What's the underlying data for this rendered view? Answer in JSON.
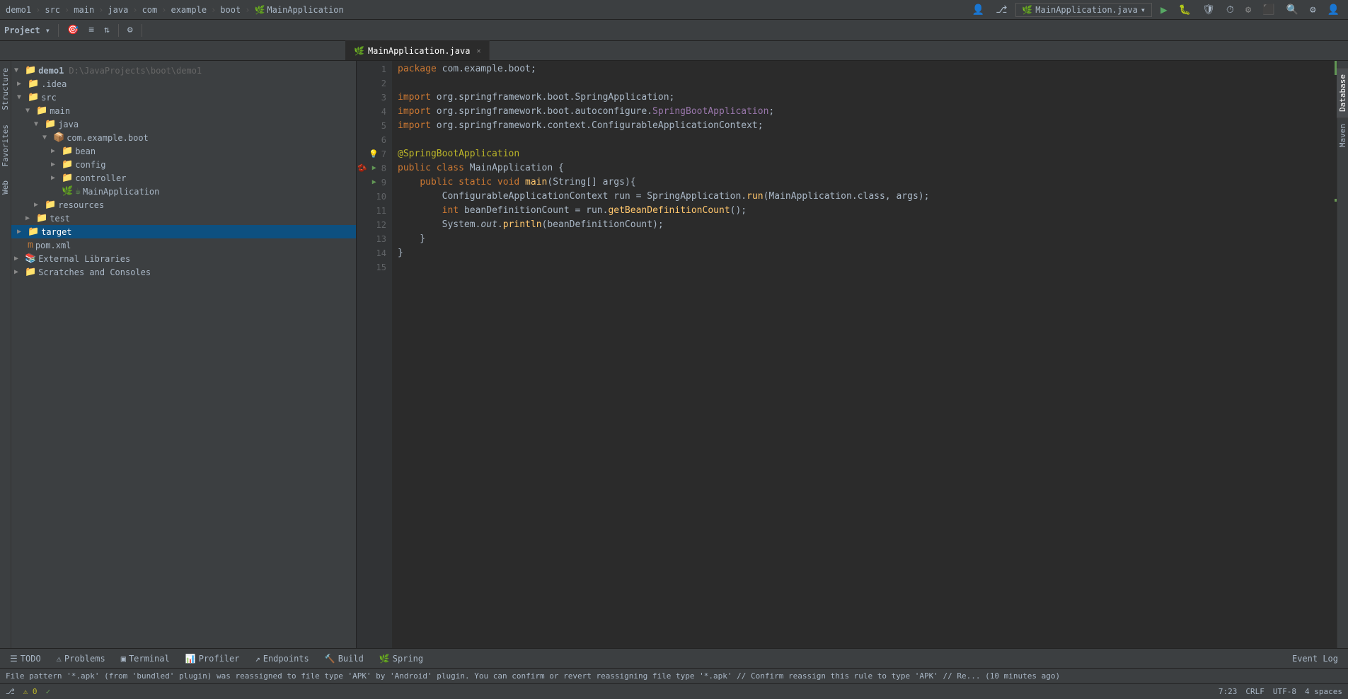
{
  "window": {
    "title": "demo1",
    "breadcrumb": [
      "demo1",
      "src",
      "main",
      "java",
      "com",
      "example",
      "boot",
      "MainApplication"
    ]
  },
  "topbar": {
    "run_config": "MainApplication",
    "icons": [
      "profile",
      "vcs",
      "run",
      "debug",
      "coverage",
      "profile-run",
      "build",
      "stop",
      "search",
      "settings",
      "avatar"
    ]
  },
  "sidebar": {
    "title": "Project",
    "tree": [
      {
        "id": "demo1",
        "label": "demo1",
        "path": "D:\\JavaProjects\\boot\\demo1",
        "type": "project",
        "level": 0,
        "expanded": true
      },
      {
        "id": "idea",
        "label": ".idea",
        "type": "folder",
        "level": 1,
        "expanded": false
      },
      {
        "id": "src",
        "label": "src",
        "type": "folder",
        "level": 1,
        "expanded": true
      },
      {
        "id": "main",
        "label": "main",
        "type": "folder",
        "level": 2,
        "expanded": true
      },
      {
        "id": "java",
        "label": "java",
        "type": "folder",
        "level": 3,
        "expanded": true
      },
      {
        "id": "com.example.boot",
        "label": "com.example.boot",
        "type": "package",
        "level": 4,
        "expanded": true
      },
      {
        "id": "bean",
        "label": "bean",
        "type": "folder",
        "level": 5,
        "expanded": false
      },
      {
        "id": "config",
        "label": "config",
        "type": "folder",
        "level": 5,
        "expanded": false
      },
      {
        "id": "controller",
        "label": "controller",
        "type": "folder",
        "level": 5,
        "expanded": false
      },
      {
        "id": "MainApplication",
        "label": "MainApplication",
        "type": "java-spring",
        "level": 5,
        "expanded": false
      },
      {
        "id": "resources",
        "label": "resources",
        "type": "folder",
        "level": 3,
        "expanded": false
      },
      {
        "id": "test",
        "label": "test",
        "type": "folder",
        "level": 2,
        "expanded": false
      },
      {
        "id": "target",
        "label": "target",
        "type": "folder",
        "level": 1,
        "expanded": false,
        "selected": true
      },
      {
        "id": "pom.xml",
        "label": "pom.xml",
        "type": "xml",
        "level": 1,
        "expanded": false
      },
      {
        "id": "external-libs",
        "label": "External Libraries",
        "type": "lib",
        "level": 0,
        "expanded": false
      },
      {
        "id": "scratches",
        "label": "Scratches and Consoles",
        "type": "folder",
        "level": 0,
        "expanded": false
      }
    ]
  },
  "editor": {
    "filename": "MainApplication.java",
    "lines": [
      {
        "num": 1,
        "content": "package com.example.boot;",
        "tokens": [
          {
            "text": "package ",
            "class": "kw"
          },
          {
            "text": "com.example.boot",
            "class": "import-pkg"
          },
          {
            "text": ";",
            "class": "type"
          }
        ]
      },
      {
        "num": 2,
        "content": ""
      },
      {
        "num": 3,
        "content": "import org.springframework.boot.SpringApplication;",
        "tokens": [
          {
            "text": "import ",
            "class": "kw"
          },
          {
            "text": "org.springframework.boot.",
            "class": "import-pkg"
          },
          {
            "text": "SpringApplication",
            "class": "import-class"
          },
          {
            "text": ";",
            "class": "type"
          }
        ]
      },
      {
        "num": 4,
        "content": "import org.springframework.boot.autoconfigure.SpringBootApplication;",
        "tokens": [
          {
            "text": "import ",
            "class": "kw"
          },
          {
            "text": "org.springframework.boot.autoconfigure.",
            "class": "import-pkg"
          },
          {
            "text": "SpringBootApplication",
            "class": "import-highlight"
          },
          {
            "text": ";",
            "class": "type"
          }
        ]
      },
      {
        "num": 5,
        "content": "import org.springframework.context.ConfigurableApplicationContext;",
        "tokens": [
          {
            "text": "import ",
            "class": "kw"
          },
          {
            "text": "org.springframework.context.",
            "class": "import-pkg"
          },
          {
            "text": "ConfigurableApplicationContext",
            "class": "import-class"
          },
          {
            "text": ";",
            "class": "type"
          }
        ]
      },
      {
        "num": 6,
        "content": ""
      },
      {
        "num": 7,
        "content": "@SpringBootApplication",
        "annotation": true,
        "has_lightbulb": true,
        "tokens": [
          {
            "text": "@SpringBootApplication",
            "class": "annotation"
          }
        ]
      },
      {
        "num": 8,
        "content": "public class MainApplication {",
        "has_bean": true,
        "has_play": true,
        "tokens": [
          {
            "text": "public ",
            "class": "kw"
          },
          {
            "text": "class ",
            "class": "kw"
          },
          {
            "text": "MainApplication",
            "class": "class-name"
          },
          {
            "text": " {",
            "class": "type"
          }
        ]
      },
      {
        "num": 9,
        "content": "    public static void main(String[] args){",
        "has_play": true,
        "tokens": [
          {
            "text": "    "
          },
          {
            "text": "public ",
            "class": "kw"
          },
          {
            "text": "static ",
            "class": "kw"
          },
          {
            "text": "void ",
            "class": "kw"
          },
          {
            "text": "main",
            "class": "method"
          },
          {
            "text": "(",
            "class": "type"
          },
          {
            "text": "String",
            "class": "class-name"
          },
          {
            "text": "[] ",
            "class": "type"
          },
          {
            "text": "args",
            "class": "param"
          },
          {
            "text": "){",
            "class": "type"
          }
        ]
      },
      {
        "num": 10,
        "content": "        ConfigurableApplicationContext run = SpringApplication.run(MainApplication.class, args);",
        "tokens": [
          {
            "text": "        "
          },
          {
            "text": "ConfigurableApplicationContext",
            "class": "class-name"
          },
          {
            "text": " run = ",
            "class": "type"
          },
          {
            "text": "SpringApplication",
            "class": "class-name"
          },
          {
            "text": ".",
            "class": "type"
          },
          {
            "text": "run",
            "class": "method"
          },
          {
            "text": "(",
            "class": "type"
          },
          {
            "text": "MainApplication",
            "class": "class-name"
          },
          {
            "text": ".class, ",
            "class": "type"
          },
          {
            "text": "args",
            "class": "param"
          },
          {
            "text": ");",
            "class": "type"
          }
        ]
      },
      {
        "num": 11,
        "content": "        int beanDefinitionCount = run.getBeanDefinitionCount();",
        "tokens": [
          {
            "text": "        "
          },
          {
            "text": "int ",
            "class": "kw"
          },
          {
            "text": "beanDefinitionCount",
            "class": "variable"
          },
          {
            "text": " = ",
            "class": "type"
          },
          {
            "text": "run",
            "class": "variable"
          },
          {
            "text": ".",
            "class": "type"
          },
          {
            "text": "getBeanDefinitionCount",
            "class": "method"
          },
          {
            "text": "();",
            "class": "type"
          }
        ]
      },
      {
        "num": 12,
        "content": "        System.out.println(beanDefinitionCount);",
        "tokens": [
          {
            "text": "        "
          },
          {
            "text": "System",
            "class": "class-name"
          },
          {
            "text": ".",
            "class": "type"
          },
          {
            "text": "out",
            "class": "variable"
          },
          {
            "text": ".",
            "class": "type"
          },
          {
            "text": "println",
            "class": "method"
          },
          {
            "text": "(",
            "class": "type"
          },
          {
            "text": "beanDefinitionCount",
            "class": "variable"
          },
          {
            "text": ");",
            "class": "type"
          }
        ]
      },
      {
        "num": 13,
        "content": "    }",
        "tokens": [
          {
            "text": "    }"
          },
          {
            "text": "",
            "class": "type"
          }
        ]
      },
      {
        "num": 14,
        "content": "}",
        "tokens": [
          {
            "text": "}",
            "class": "type"
          }
        ]
      },
      {
        "num": 15,
        "content": ""
      }
    ]
  },
  "bottom_tabs": [
    {
      "label": "TODO",
      "icon": "☰"
    },
    {
      "label": "Problems",
      "icon": "⚠"
    },
    {
      "label": "Terminal",
      "icon": "▣"
    },
    {
      "label": "Profiler",
      "icon": "📊"
    },
    {
      "label": "Endpoints",
      "icon": "↗"
    },
    {
      "label": "Build",
      "icon": "🔨"
    },
    {
      "label": "Spring",
      "icon": "🌿"
    }
  ],
  "status_bar": {
    "line": "7:23",
    "encoding": "UTF-8",
    "line_separator": "CRLF",
    "indent": "4 spaces",
    "event_log": "Event Log",
    "success_icon": "✓"
  },
  "notification": "File pattern '*.apk' (from 'bundled' plugin) was reassigned to file type 'APK' by 'Android' plugin. You can confirm or revert reassigning file type '*.apk' // Confirm reassign this rule to type 'APK' // Re... (10 minutes ago)",
  "right_panels": [
    "Database",
    "Maven",
    "Structure"
  ],
  "left_panels": [
    "Structure",
    "Favorites",
    "Web"
  ]
}
